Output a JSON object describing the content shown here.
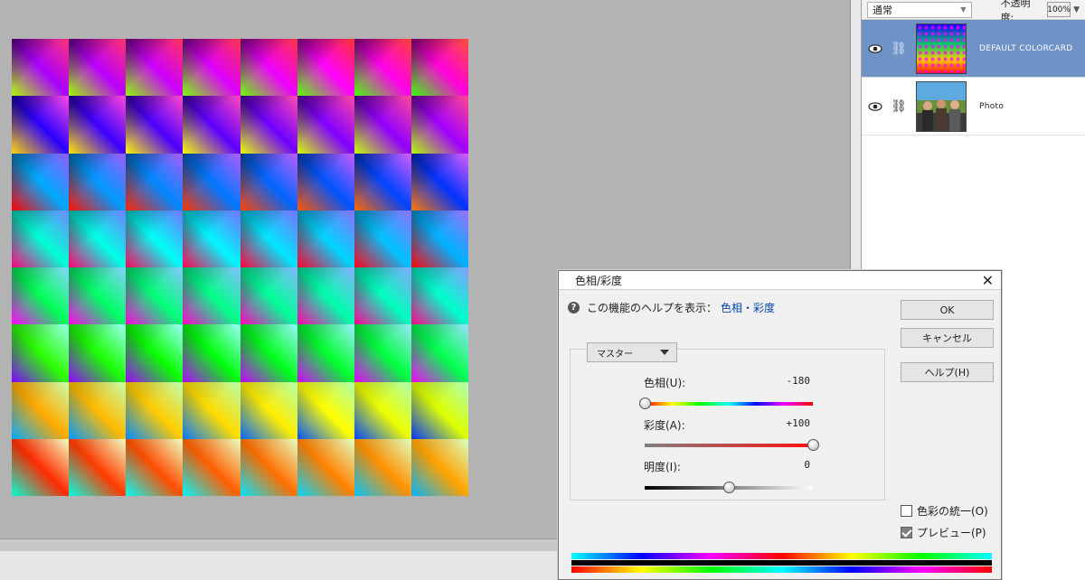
{
  "layers_panel": {
    "blend_mode": "通常",
    "opacity_label": "不透明度:",
    "opacity_value": "100%",
    "layers": [
      {
        "name": "DEFAULT COLORCARD",
        "selected": true,
        "thumb_icon": "colorcard-thumbnail"
      },
      {
        "name": "Photo",
        "selected": false,
        "thumb_icon": "photo-thumbnail"
      }
    ]
  },
  "dialog": {
    "title": "色相/彩度",
    "help_text": "この機能のヘルプを表示：",
    "help_link": "色相・彩度",
    "buttons": {
      "ok": "OK",
      "cancel": "キャンセル",
      "help": "ヘルプ(H)"
    },
    "channel": "マスター",
    "hue": {
      "label": "色相(U):",
      "value": "-180",
      "min": -180,
      "max": 180
    },
    "saturation": {
      "label": "彩度(A):",
      "value": "+100",
      "min": -100,
      "max": 100
    },
    "lightness": {
      "label": "明度(I):",
      "value": "0",
      "min": -100,
      "max": 100
    },
    "colorize": {
      "label": "色彩の統一(O)",
      "checked": false
    },
    "preview": {
      "label": "プレビュー(P)",
      "checked": true
    }
  },
  "colors": {
    "selected_layer": "#6f93c7",
    "help_link": "#0645ad"
  }
}
